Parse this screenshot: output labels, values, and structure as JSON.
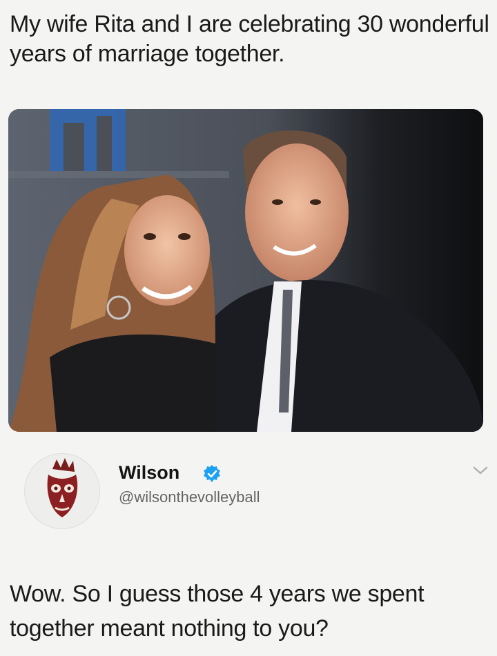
{
  "post": {
    "text": "My wife Rita and I are celebrating 30 wonderful years of marriage together."
  },
  "reply": {
    "author": {
      "display_name": "Wilson",
      "handle": "@wilsonthevolleyball",
      "verified": true,
      "avatar_icon": "volleyball-face-icon"
    },
    "text": "Wow. So I guess those 4 years we spent together meant nothing to you?"
  },
  "colors": {
    "background": "#f4f4f2",
    "verified_badge": "#1da1f2",
    "handle_text": "#666666"
  }
}
